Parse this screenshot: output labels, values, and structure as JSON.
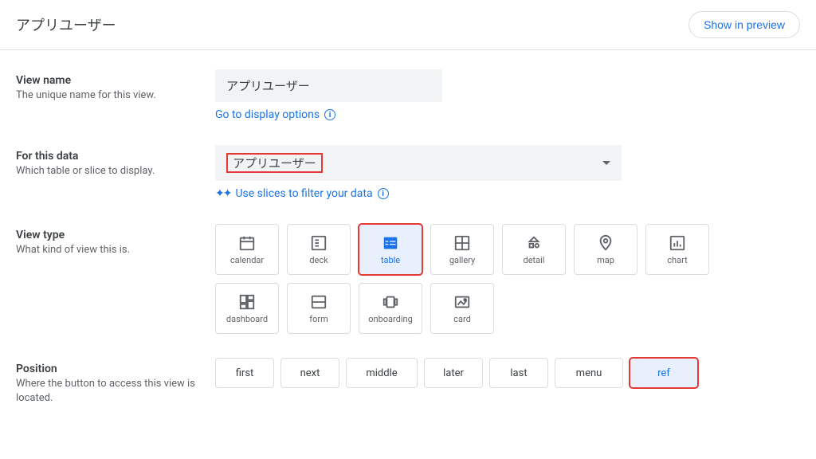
{
  "header": {
    "title": "アプリユーザー",
    "preview_button": "Show in preview"
  },
  "view_name": {
    "label": "View name",
    "desc": "The unique name for this view.",
    "value": "アプリユーザー",
    "display_link": "Go to display options"
  },
  "for_data": {
    "label": "For this data",
    "desc": "Which table or slice to display.",
    "value": "アプリユーザー",
    "slices_link": "Use slices to filter your data"
  },
  "view_type": {
    "label": "View type",
    "desc": "What kind of view this is.",
    "tiles": [
      {
        "key": "calendar",
        "label": "calendar"
      },
      {
        "key": "deck",
        "label": "deck"
      },
      {
        "key": "table",
        "label": "table"
      },
      {
        "key": "gallery",
        "label": "gallery"
      },
      {
        "key": "detail",
        "label": "detail"
      },
      {
        "key": "map",
        "label": "map"
      },
      {
        "key": "chart",
        "label": "chart"
      },
      {
        "key": "dashboard",
        "label": "dashboard"
      },
      {
        "key": "form",
        "label": "form"
      },
      {
        "key": "onboarding",
        "label": "onboarding"
      },
      {
        "key": "card",
        "label": "card"
      }
    ],
    "selected": "table"
  },
  "position": {
    "label": "Position",
    "desc": "Where the button to access this view is located.",
    "options": [
      "first",
      "next",
      "middle",
      "later",
      "last",
      "menu",
      "ref"
    ],
    "selected": "ref"
  }
}
